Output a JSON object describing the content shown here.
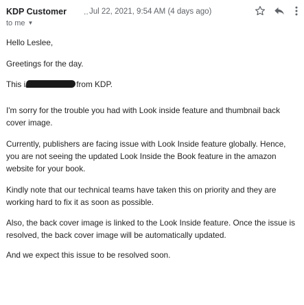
{
  "header": {
    "sender": "KDP Customer",
    "sender_truncation": "..",
    "date": "Jul 22, 2021, 9:54 AM (4 days ago)",
    "recipient_label": "to me",
    "icons": {
      "star": "star-outline-icon",
      "reply": "reply-arrow-icon",
      "more": "vertical-dots-icon",
      "dropdown": "caret-down-icon"
    }
  },
  "body": {
    "greeting": "Hello Leslee,",
    "greetings_line": "Greetings for the day.",
    "this_prefix": "This i",
    "this_suffix": "from KDP.",
    "sorry": "I'm sorry for the trouble you had with Look inside feature and thumbnail back cover image.",
    "currently": "Currently, publishers are facing issue with Look Inside feature globally. Hence, you are not seeing the updated Look Inside the Book feature in the amazon website for your book.",
    "kindly": "Kindly note that our technical teams have taken this on priority and they are working hard to fix it as soon as possible.",
    "also": "Also, the back cover image is linked to the Look Inside feature. Once the issue is resolved, the back cover image will be automatically updated.",
    "expect": "And we expect this issue to be resolved soon."
  },
  "colors": {
    "text": "#222222",
    "secondary_text": "#5f6368",
    "icon": "#5f6368",
    "redaction": "#1a1a1a"
  }
}
